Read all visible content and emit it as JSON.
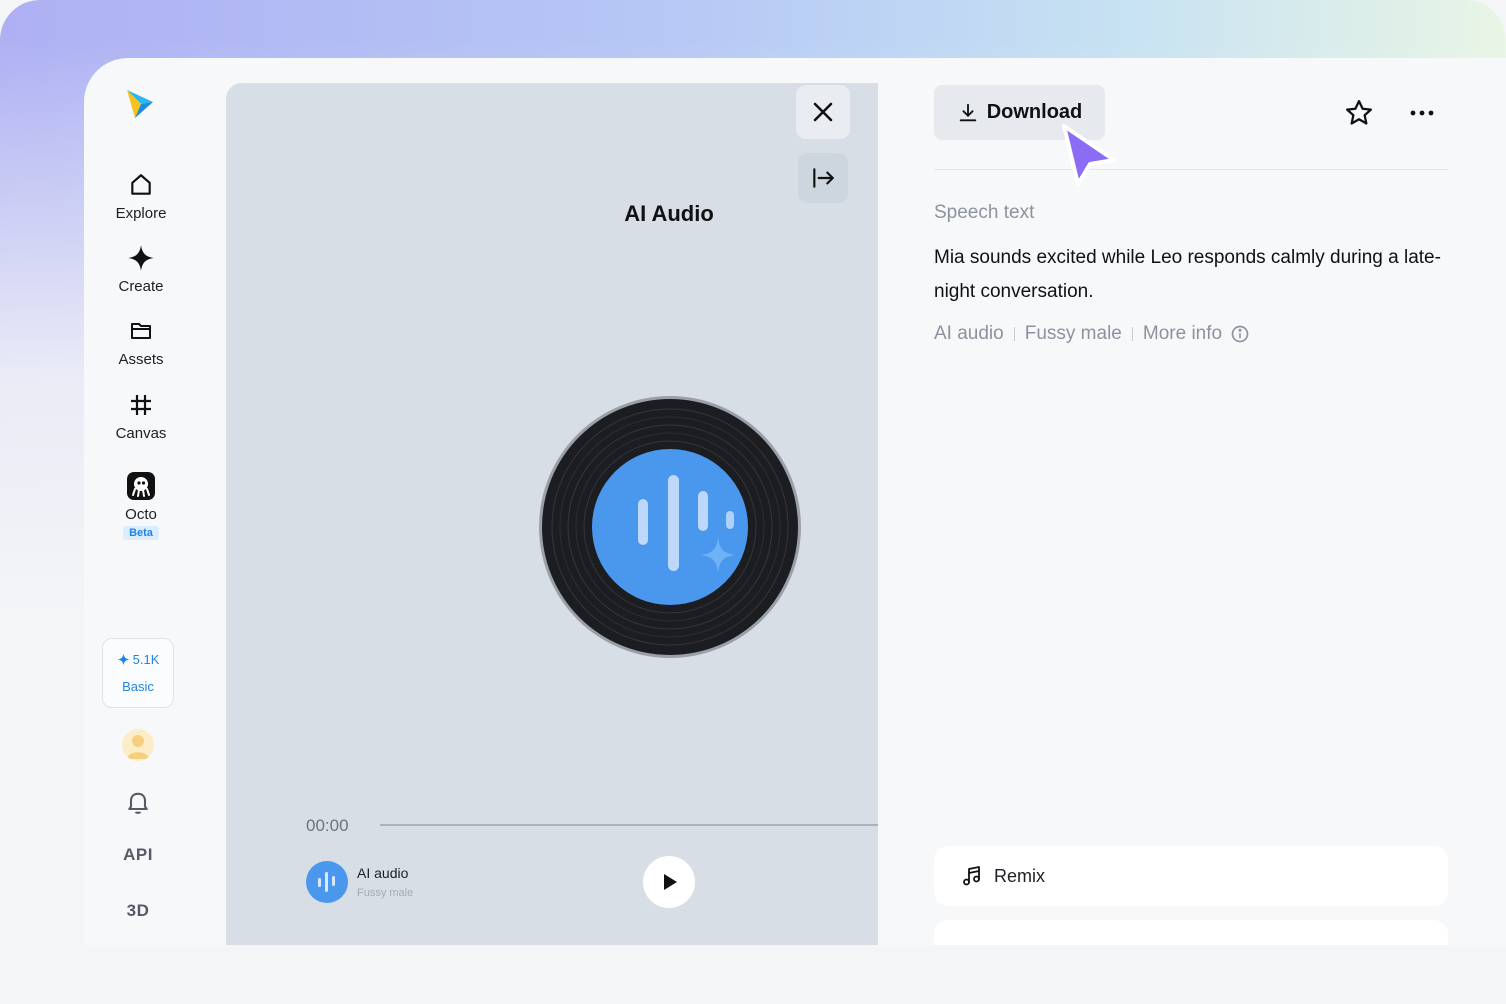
{
  "sidebar": {
    "nav": [
      {
        "label": "Explore",
        "icon": "home-icon"
      },
      {
        "label": "Create",
        "icon": "sparkle-icon"
      },
      {
        "label": "Assets",
        "icon": "folder-icon"
      },
      {
        "label": "Canvas",
        "icon": "canvas-grid-icon"
      },
      {
        "label": "Octo",
        "icon": "octo-icon",
        "badge": "Beta"
      }
    ],
    "credits": {
      "amount": "5.1K",
      "plan": "Basic"
    },
    "links": {
      "api": "API",
      "three_d": "3D"
    }
  },
  "player": {
    "title": "AI Audio",
    "time": "00:00",
    "progress": 0,
    "track": {
      "title": "AI audio",
      "subtitle": "Fussy male"
    }
  },
  "details": {
    "download_label": "Download",
    "speech_label": "Speech text",
    "speech_text": "Mia sounds excited while Leo responds calmly during a late-night conversation.",
    "tags": [
      "AI audio",
      "Fussy male"
    ],
    "more_info_label": "More info",
    "remix_label": "Remix"
  },
  "colors": {
    "accent": "#1e86e8",
    "cursor": "#8b6cf5",
    "player_bg": "#d7dee6",
    "vinyl_center": "#4a97ee"
  }
}
